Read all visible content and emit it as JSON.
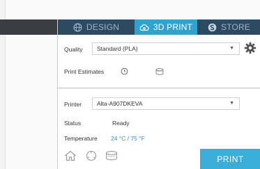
{
  "tabs": [
    {
      "label": "DESIGN",
      "icon": "globe-icon"
    },
    {
      "label": "3D PRINT",
      "icon": "cloud-print-icon"
    },
    {
      "label": "STORE",
      "icon": "store-icon"
    }
  ],
  "active_tab": "3D PRINT",
  "print_settings": {
    "quality_label": "Quality",
    "quality_value": "Standard (PLA)",
    "estimates_label": "Print Estimates",
    "estimate_icons": [
      "clock-icon",
      "spool-icon"
    ],
    "settings_icon": "gear-icon"
  },
  "printer": {
    "printer_label": "Printer",
    "printer_value": "Alta-A907DKEVA",
    "status_label": "Status",
    "status_value": "Ready",
    "temperature_label": "Temperature",
    "temperature_value": "24 °C / 75 °F",
    "footer_icons": [
      "home-icon",
      "build-plate-icon",
      "filament-icon"
    ]
  },
  "print_button_label": "PRINT",
  "colors": {
    "tab_bar": "#2d4a63",
    "tab_active": "#2fa3cd",
    "tab_text": "#9fb3c4",
    "print_button": "#3aaed8",
    "temperature_text": "#2f8fc7"
  }
}
